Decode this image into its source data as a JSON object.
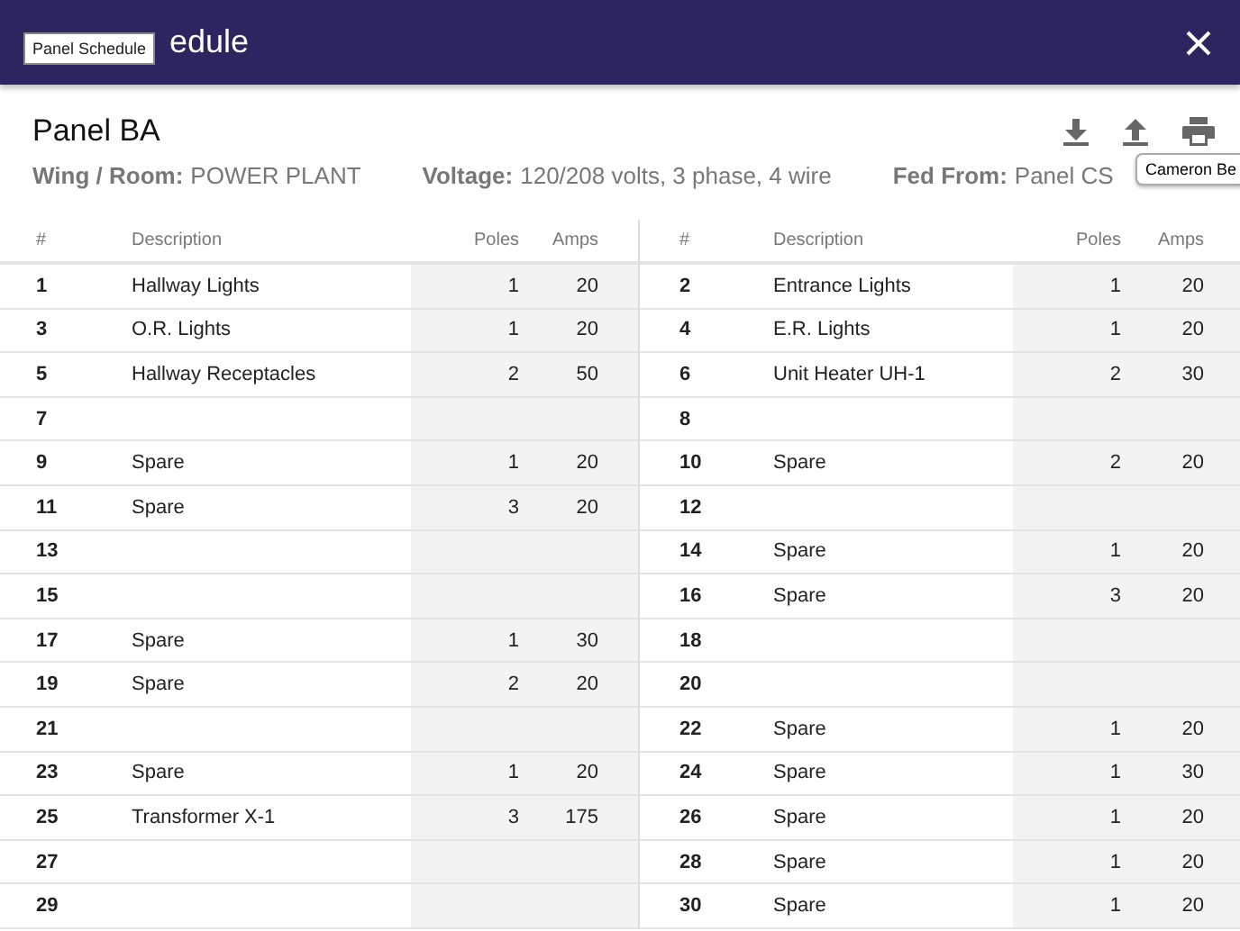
{
  "header": {
    "title": "edule",
    "tooltip": "Panel Schedule"
  },
  "panel": {
    "name": "Panel BA",
    "info": [
      {
        "label": "Wing / Room:",
        "value": "POWER PLANT"
      },
      {
        "label": "Voltage:",
        "value": "120/208 volts, 3 phase, 4 wire"
      },
      {
        "label": "Fed From:",
        "value": "Panel CS"
      }
    ],
    "print_tooltip": "Cameron Be"
  },
  "left_columns": [
    "#",
    "Description",
    "Poles",
    "Amps"
  ],
  "right_columns": [
    "#",
    "Description",
    "Poles",
    "Amps"
  ],
  "left_rows": [
    {
      "num": "1",
      "description": "Hallway Lights",
      "poles": "1",
      "amps": "20"
    },
    {
      "num": "3",
      "description": "O.R. Lights",
      "poles": "1",
      "amps": "20"
    },
    {
      "num": "5",
      "description": "Hallway Receptacles",
      "poles": "2",
      "amps": "50"
    },
    {
      "num": "7"
    },
    {
      "num": "9",
      "description": "Spare",
      "poles": "1",
      "amps": "20"
    },
    {
      "num": "11",
      "description": "Spare",
      "poles": "3",
      "amps": "20"
    },
    {
      "num": "13"
    },
    {
      "num": "15"
    },
    {
      "num": "17",
      "description": "Spare",
      "poles": "1",
      "amps": "30"
    },
    {
      "num": "19",
      "description": "Spare",
      "poles": "2",
      "amps": "20"
    },
    {
      "num": "21"
    },
    {
      "num": "23",
      "description": "Spare",
      "poles": "1",
      "amps": "20"
    },
    {
      "num": "25",
      "description": "Transformer X-1",
      "poles": "3",
      "amps": "175"
    },
    {
      "num": "27"
    },
    {
      "num": "29"
    }
  ],
  "right_rows": [
    {
      "num": "2",
      "description": "Entrance Lights",
      "poles": "1",
      "amps": "20"
    },
    {
      "num": "4",
      "description": "E.R. Lights",
      "poles": "1",
      "amps": "20"
    },
    {
      "num": "6",
      "description": "Unit Heater UH-1",
      "poles": "2",
      "amps": "30"
    },
    {
      "num": "8"
    },
    {
      "num": "10",
      "description": "Spare",
      "poles": "2",
      "amps": "20"
    },
    {
      "num": "12"
    },
    {
      "num": "14",
      "description": "Spare",
      "poles": "1",
      "amps": "20"
    },
    {
      "num": "16",
      "description": "Spare",
      "poles": "3",
      "amps": "20"
    },
    {
      "num": "18"
    },
    {
      "num": "20"
    },
    {
      "num": "22",
      "description": "Spare",
      "poles": "1",
      "amps": "20"
    },
    {
      "num": "24",
      "description": "Spare",
      "poles": "1",
      "amps": "30"
    },
    {
      "num": "26",
      "description": "Spare",
      "poles": "1",
      "amps": "20"
    },
    {
      "num": "28",
      "description": "Spare",
      "poles": "1",
      "amps": "20"
    },
    {
      "num": "30",
      "description": "Spare",
      "poles": "1",
      "amps": "20"
    }
  ]
}
